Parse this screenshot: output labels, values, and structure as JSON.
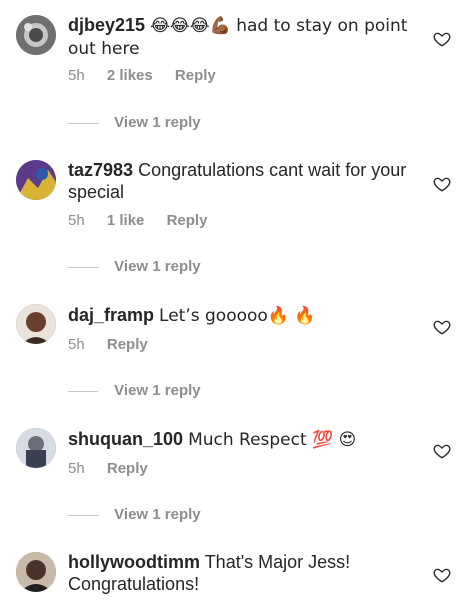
{
  "comments": [
    {
      "username": "djbey215",
      "text": "😂😂😂💪🏾 had to stay on point out here",
      "time": "5h",
      "likes": "2 likes",
      "reply": "Reply",
      "view_replies": "View 1 reply",
      "avatar_color": "#6f6f6f"
    },
    {
      "username": "taz7983",
      "text": "Congratulations cant wait for your special",
      "time": "5h",
      "likes": "1 like",
      "reply": "Reply",
      "view_replies": "View 1 reply",
      "avatar_color": "#5b3a8c"
    },
    {
      "username": "daj_framp",
      "text": "Let’s gooooo🔥 🔥",
      "time": "5h",
      "reply": "Reply",
      "view_replies": "View 1 reply",
      "avatar_color": "#6b3f2f"
    },
    {
      "username": "shuquan_100",
      "text": "Much Respect 💯 😍",
      "time": "5h",
      "reply": "Reply",
      "view_replies": "View 1 reply",
      "avatar_color": "#6d6d7a"
    },
    {
      "username": "hollywoodtimm",
      "text": "That's Major Jess! Congratulations!",
      "avatar_color": "#4a3328"
    }
  ],
  "icons": {
    "like": "heart-outline-icon"
  },
  "colors": {
    "text": "#262626",
    "muted": "#8e8e8e",
    "background": "#ffffff"
  }
}
